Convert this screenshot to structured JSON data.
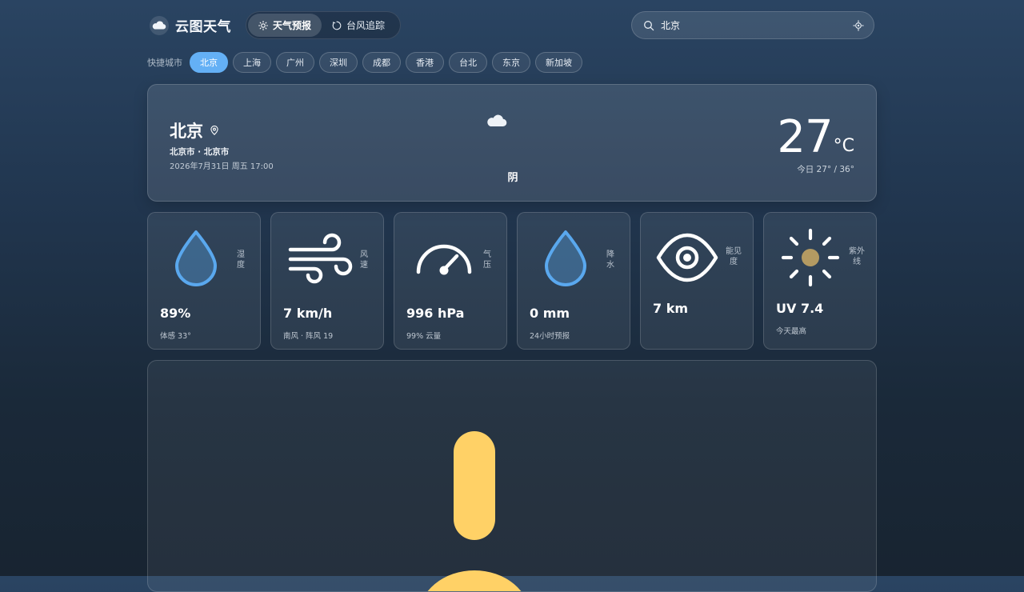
{
  "app": {
    "name": "云图天气",
    "logo_icon": "cloud-icon"
  },
  "tabs": [
    {
      "label": "天气预报",
      "icon": "sun-icon",
      "active": true
    },
    {
      "label": "台风追踪",
      "icon": "typhoon-icon",
      "active": false
    }
  ],
  "search": {
    "value": "北京",
    "icon": "search-icon",
    "locate_icon": "locate-icon"
  },
  "quick_cities": {
    "label": "快捷城市",
    "items": [
      "北京",
      "上海",
      "广州",
      "深圳",
      "成都",
      "香港",
      "台北",
      "东京",
      "新加坡"
    ],
    "active": "北京"
  },
  "current": {
    "city": "北京",
    "region": "北京市 · 北京市",
    "datetime": "2026年7月31日 周五 17:00",
    "condition": "阴",
    "condition_icon": "cloud-icon",
    "temperature": "27",
    "unit": "°C",
    "range": "今日 27° / 36°"
  },
  "metrics": [
    {
      "label": "湿度",
      "value": "89%",
      "sub": "体感 33°",
      "icon": "droplet-icon"
    },
    {
      "label": "风速",
      "value": "7 km/h",
      "sub": "南风 · 阵风 19",
      "icon": "wind-icon"
    },
    {
      "label": "气压",
      "value": "996 hPa",
      "sub": "99% 云量",
      "icon": "gauge-icon"
    },
    {
      "label": "降水",
      "value": "0 mm",
      "sub": "24小时预报",
      "icon": "droplet-icon"
    },
    {
      "label": "能见度",
      "value": "7 km",
      "sub": "",
      "icon": "eye-icon"
    },
    {
      "label": "紫外线",
      "value": "UV 7.4",
      "sub": "今天最高",
      "icon": "sun-icon"
    }
  ],
  "colors": {
    "accent": "#64b0f5",
    "droplet": "#5aa8ee",
    "sun_core": "#b39a62",
    "big_sun": "#ffd166"
  },
  "big_panel": {
    "icon": "sun-icon"
  }
}
